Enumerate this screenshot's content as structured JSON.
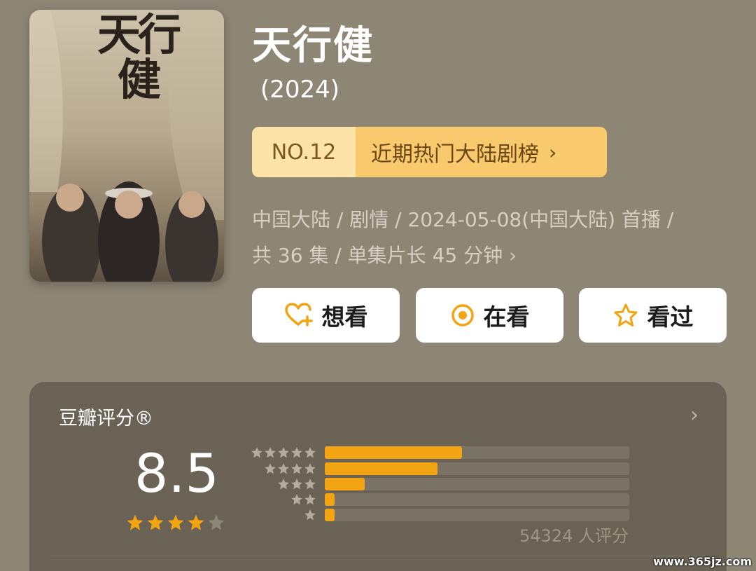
{
  "poster": {
    "title_text": "天行健",
    "alt": "天行健 poster"
  },
  "header": {
    "title": "天行健",
    "year": "(2024)"
  },
  "rank": {
    "number": "NO.12",
    "label": "近期热门大陆剧榜",
    "chevron": "›"
  },
  "meta": {
    "line1": "中国大陆 / 剧情 / 2024-05-08(中国大陆) 首播 /",
    "line2": "共 36 集 / 单集片长 45 分钟",
    "chevron": "›"
  },
  "actions": [
    {
      "label": "想看",
      "icon": "heart-plus-icon"
    },
    {
      "label": "在看",
      "icon": "target-circle-icon"
    },
    {
      "label": "看过",
      "icon": "star-outline-icon"
    }
  ],
  "rating": {
    "title": "豆瓣评分®",
    "chevron": "›",
    "score": "8.5",
    "stars": 4,
    "count_text": "54324 人评分",
    "distribution": [
      {
        "stars": 5,
        "fraction": 0.45
      },
      {
        "stars": 4,
        "fraction": 0.37
      },
      {
        "stars": 3,
        "fraction": 0.13
      },
      {
        "stars": 2,
        "fraction": 0.03
      },
      {
        "stars": 1,
        "fraction": 0.03
      }
    ]
  },
  "colors": {
    "accent": "#f2a413",
    "background": "#8e8675",
    "card": "#6a6355"
  },
  "watermark": "www.365jz.com"
}
